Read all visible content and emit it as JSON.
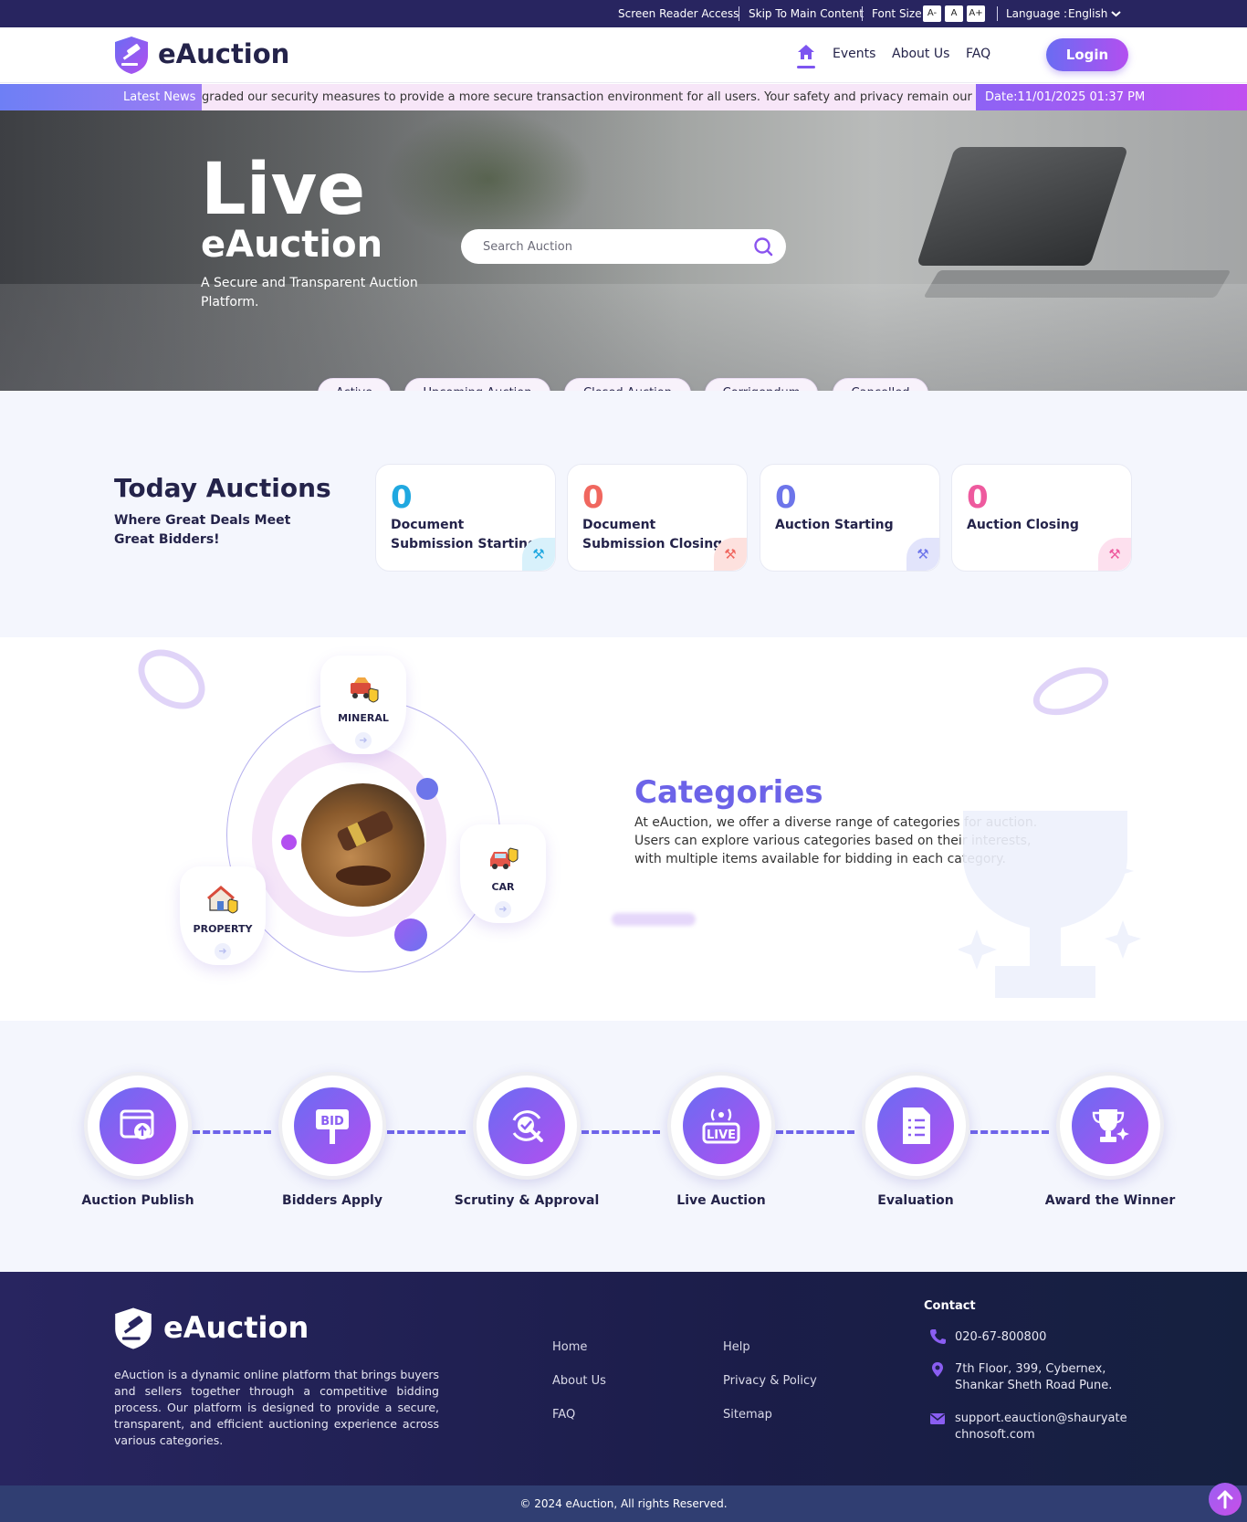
{
  "topbar": {
    "screen_reader": "Screen Reader Access",
    "skip_main": "Skip To Main Content",
    "font_size_label": "Font Size :",
    "font_decrease": "A-",
    "font_normal": "A",
    "font_increase": "A+",
    "language_label": "Language :",
    "language_value": "English"
  },
  "header": {
    "logo_text": "eAuction",
    "nav": [
      "Events",
      "About Us",
      "FAQ"
    ],
    "login_label": "Login"
  },
  "news": {
    "label": "Latest News",
    "text": "graded our security measures to provide a more secure transaction environment for all users. Your safety and privacy remain our top",
    "date": "Date:11/01/2025 01:37 PM"
  },
  "hero": {
    "title_big": "Live",
    "title_sub": "eAuction",
    "tagline": "A Secure and Transparent Auction Platform.",
    "search_placeholder": "Search Auction"
  },
  "status_tabs": [
    "Active",
    "Upcoming Auction",
    "Closed Auction",
    "Corrigendum",
    "Cancelled"
  ],
  "today": {
    "title": "Today Auctions",
    "subtitle": "Where Great Deals Meet Great Bidders!",
    "cards": [
      {
        "count": "0",
        "label": "Document Submission Starting",
        "color": "#20a8e0"
      },
      {
        "count": "0",
        "label": "Document Submission Closing",
        "color": "#f0675f"
      },
      {
        "count": "0",
        "label": "Auction Starting",
        "color": "#6d75ea"
      },
      {
        "count": "0",
        "label": "Auction Closing",
        "color": "#ee5a9e"
      }
    ]
  },
  "categories": {
    "title": "Categories",
    "description": "At eAuction, we offer a diverse range of categories for auction. Users can explore various categories based on their interests, with multiple items available for bidding in each category.",
    "items": [
      "MINERAL",
      "CAR",
      "PROPERTY"
    ]
  },
  "process": {
    "steps": [
      "Auction Publish",
      "Bidders Apply",
      "Scrutiny & Approval",
      "Live Auction",
      "Evaluation",
      "Award the Winner"
    ],
    "bid_text": "BID",
    "live_text": "LIVE"
  },
  "footer": {
    "logo_text": "eAuction",
    "description": "eAuction is a dynamic online platform that brings buyers and sellers together through a competitive bidding process. Our platform is designed to provide a secure, transparent, and efficient auctioning experience across various categories.",
    "links_col1": [
      "Home",
      "About Us",
      "FAQ"
    ],
    "links_col2": [
      "Help",
      "Privacy & Policy",
      "Sitemap"
    ],
    "contact_title": "Contact",
    "phone": "020-67-800800",
    "address": "7th Floor, 399, Cybernex, Shankar Sheth Road Pune.",
    "email": "support.eauction@shauryatechnosoft.com",
    "copyright": "© 2024 eAuction, All rights Reserved."
  },
  "colors": {
    "brand_purple": "#7d55f0",
    "brand_navy": "#282560",
    "accent_gradient_start": "#6a6cf2",
    "accent_gradient_end": "#b34ff0"
  }
}
